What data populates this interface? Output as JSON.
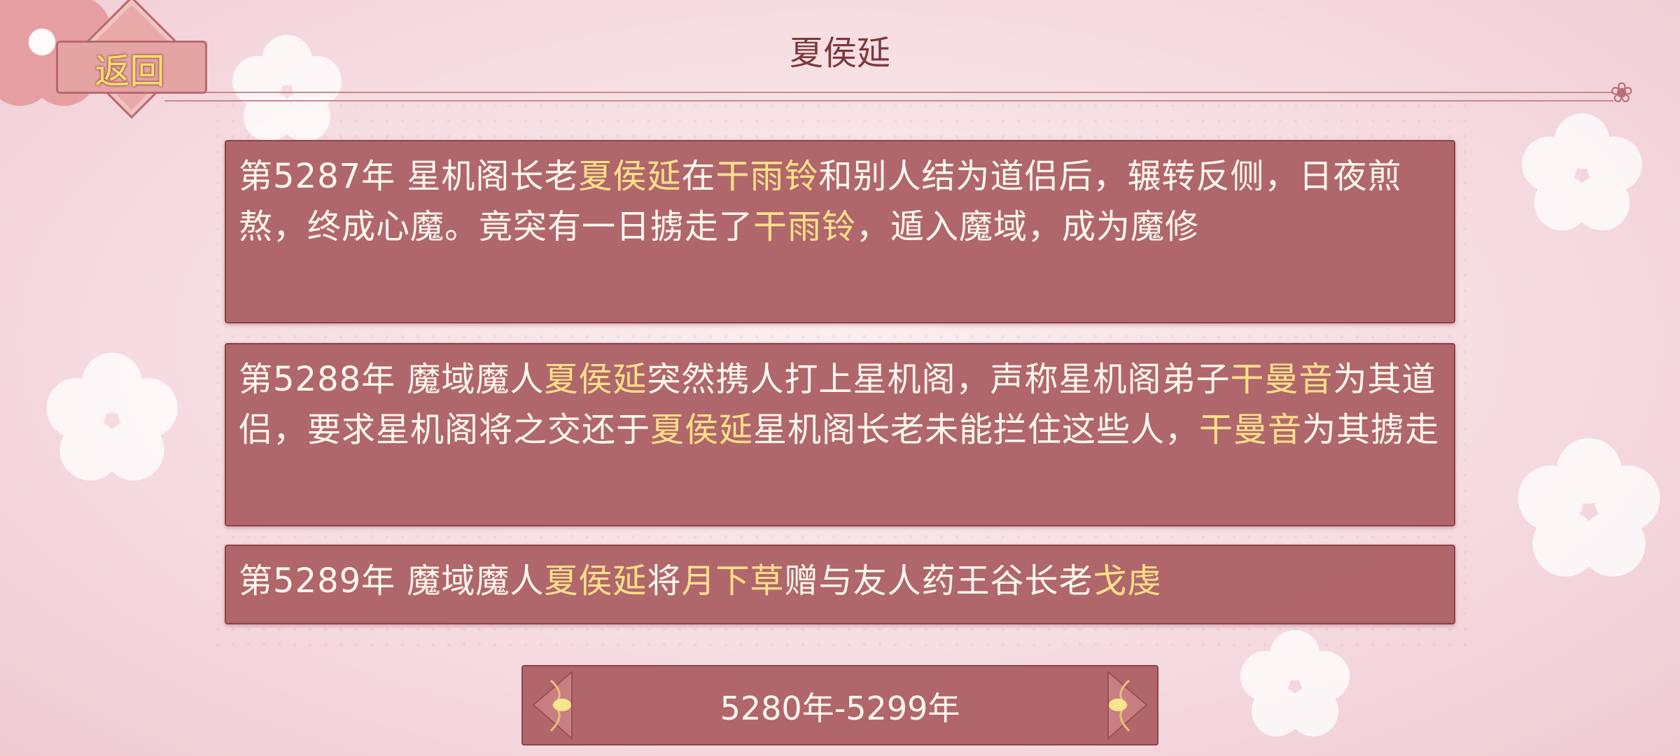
{
  "header": {
    "title": "夏侯延",
    "back_label": "返回"
  },
  "events": [
    {
      "segments": [
        {
          "text": "第5287年 星机阁长老",
          "hl": false
        },
        {
          "text": "夏侯延",
          "hl": true
        },
        {
          "text": "在",
          "hl": false
        },
        {
          "text": "干雨铃",
          "hl": true
        },
        {
          "text": "和别人结为道侣后，辗转反侧，日夜煎熬，终成心魔。竟突有一日掳走了",
          "hl": false
        },
        {
          "text": "干雨铃",
          "hl": true
        },
        {
          "text": "，遁入魔域，成为魔修",
          "hl": false
        }
      ]
    },
    {
      "segments": [
        {
          "text": "第5288年 魔域魔人",
          "hl": false
        },
        {
          "text": "夏侯延",
          "hl": true
        },
        {
          "text": "突然携人打上星机阁，声称星机阁弟子",
          "hl": false
        },
        {
          "text": "干曼音",
          "hl": true
        },
        {
          "text": "为其道侣，要求星机阁将之交还于",
          "hl": false
        },
        {
          "text": "夏侯延",
          "hl": true
        },
        {
          "text": "星机阁长老未能拦住这些人，",
          "hl": false
        },
        {
          "text": "干曼音",
          "hl": true
        },
        {
          "text": "为其掳走",
          "hl": false
        }
      ]
    },
    {
      "segments": [
        {
          "text": "第5289年 魔域魔人",
          "hl": false
        },
        {
          "text": "夏侯延",
          "hl": true
        },
        {
          "text": "将",
          "hl": false
        },
        {
          "text": "月下草",
          "hl": true
        },
        {
          "text": "赠与友人药王谷长老",
          "hl": false
        },
        {
          "text": "戈虔",
          "hl": true
        }
      ]
    }
  ],
  "period": {
    "label": "5280年-5299年"
  },
  "colors": {
    "card_bg": "#ac6064",
    "highlight": "#ffe08a",
    "title": "#7a3a3e"
  },
  "icons": {
    "prev": "scroll-left-arrow-icon",
    "next": "scroll-right-arrow-icon",
    "back": "diamond-frame-icon"
  }
}
